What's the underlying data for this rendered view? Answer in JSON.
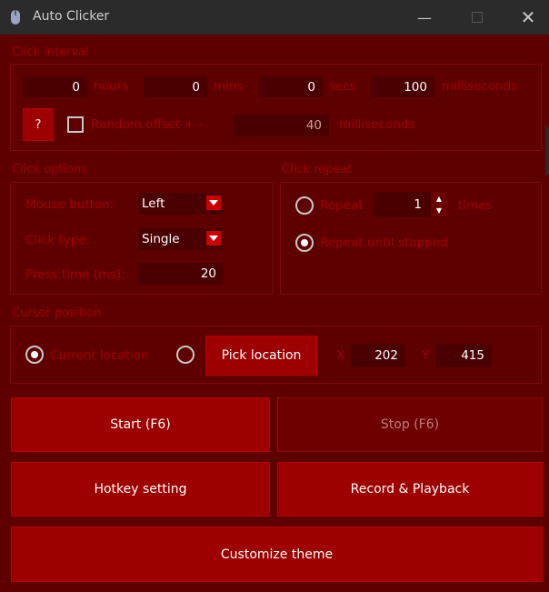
{
  "window": {
    "title": "Auto Clicker"
  },
  "click_interval": {
    "title": "Click interval",
    "hours": {
      "value": "0",
      "unit": "hours"
    },
    "mins": {
      "value": "0",
      "unit": "mins"
    },
    "secs": {
      "value": "0",
      "unit": "secs"
    },
    "ms": {
      "value": "100",
      "unit": "milliseconds"
    },
    "help_label": "?",
    "random_offset": {
      "label": "Random offset + -",
      "value": "40",
      "unit": "milliseconds",
      "checked": false
    }
  },
  "click_options": {
    "title": "Click options",
    "mouse_button": {
      "label": "Mouse button:",
      "value": "Left"
    },
    "click_type": {
      "label": "Click type:",
      "value": "Single"
    },
    "press_time": {
      "label": "Press time (ms):",
      "value": "20"
    }
  },
  "click_repeat": {
    "title": "Click repeat",
    "repeat": {
      "label": "Repeat",
      "value": "1",
      "unit": "times",
      "selected": false
    },
    "repeat_until_stopped": {
      "label": "Repeat until stopped",
      "selected": true
    }
  },
  "cursor_position": {
    "title": "Cursor position",
    "current_location": {
      "label": "Current location",
      "selected": true
    },
    "pick_location": {
      "label": "Pick location",
      "selected": false
    },
    "x": {
      "label": "X",
      "value": "202"
    },
    "y": {
      "label": "Y",
      "value": "415"
    }
  },
  "buttons": {
    "start": "Start (F6)",
    "stop": "Stop (F6)",
    "hotkey": "Hotkey setting",
    "record": "Record & Playback",
    "theme": "Customize theme"
  },
  "colors": {
    "background": "#5e0000",
    "button": "#9e0000",
    "label": "#a40000",
    "field": "#4a0000"
  },
  "icons": [
    "mouse-icon",
    "minimize-icon",
    "maximize-icon",
    "close-icon",
    "chevron-down-icon",
    "spin-up-icon",
    "spin-down-icon"
  ]
}
